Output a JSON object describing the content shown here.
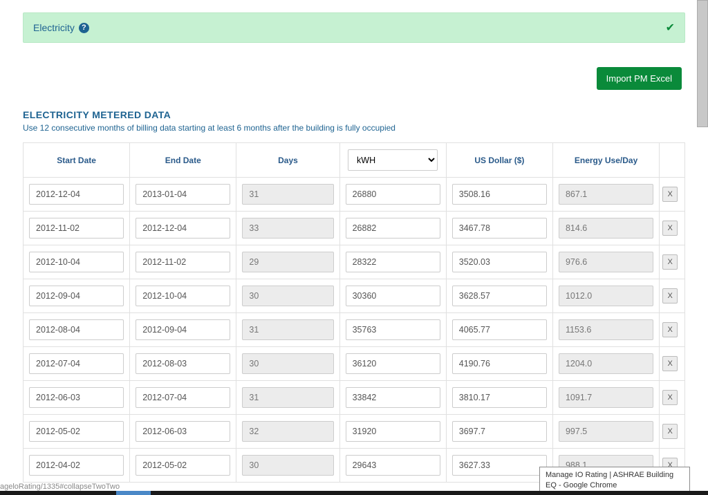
{
  "panel": {
    "title": "Electricity"
  },
  "buttons": {
    "import": "Import PM Excel"
  },
  "section": {
    "title": "ELECTRICITY METERED DATA",
    "description": "Use 12 consecutive months of billing data starting at least 6 months after the building is fully occupied"
  },
  "headers": {
    "start_date": "Start Date",
    "end_date": "End Date",
    "days": "Days",
    "energy_unit": "kWH",
    "cost": "US Dollar ($)",
    "energy_per_day": "Energy Use/Day"
  },
  "rows": [
    {
      "start": "2012-12-04",
      "end": "2013-01-04",
      "days": "31",
      "kwh": "26880",
      "dollar": "3508.16",
      "energy_day": "867.1"
    },
    {
      "start": "2012-11-02",
      "end": "2012-12-04",
      "days": "33",
      "kwh": "26882",
      "dollar": "3467.78",
      "energy_day": "814.6"
    },
    {
      "start": "2012-10-04",
      "end": "2012-11-02",
      "days": "29",
      "kwh": "28322",
      "dollar": "3520.03",
      "energy_day": "976.6"
    },
    {
      "start": "2012-09-04",
      "end": "2012-10-04",
      "days": "30",
      "kwh": "30360",
      "dollar": "3628.57",
      "energy_day": "1012.0"
    },
    {
      "start": "2012-08-04",
      "end": "2012-09-04",
      "days": "31",
      "kwh": "35763",
      "dollar": "4065.77",
      "energy_day": "1153.6"
    },
    {
      "start": "2012-07-04",
      "end": "2012-08-03",
      "days": "30",
      "kwh": "36120",
      "dollar": "4190.76",
      "energy_day": "1204.0"
    },
    {
      "start": "2012-06-03",
      "end": "2012-07-04",
      "days": "31",
      "kwh": "33842",
      "dollar": "3810.17",
      "energy_day": "1091.7"
    },
    {
      "start": "2012-05-02",
      "end": "2012-06-03",
      "days": "32",
      "kwh": "31920",
      "dollar": "3697.7",
      "energy_day": "997.5"
    },
    {
      "start": "2012-04-02",
      "end": "2012-05-02",
      "days": "30",
      "kwh": "29643",
      "dollar": "3627.33",
      "energy_day": "988.1"
    }
  ],
  "delete_label": "X",
  "status_text": "ageloRating/1335#collapseTwoTwo",
  "tooltip": "Manage IO Rating | ASHRAE Building EQ - Google Chrome"
}
